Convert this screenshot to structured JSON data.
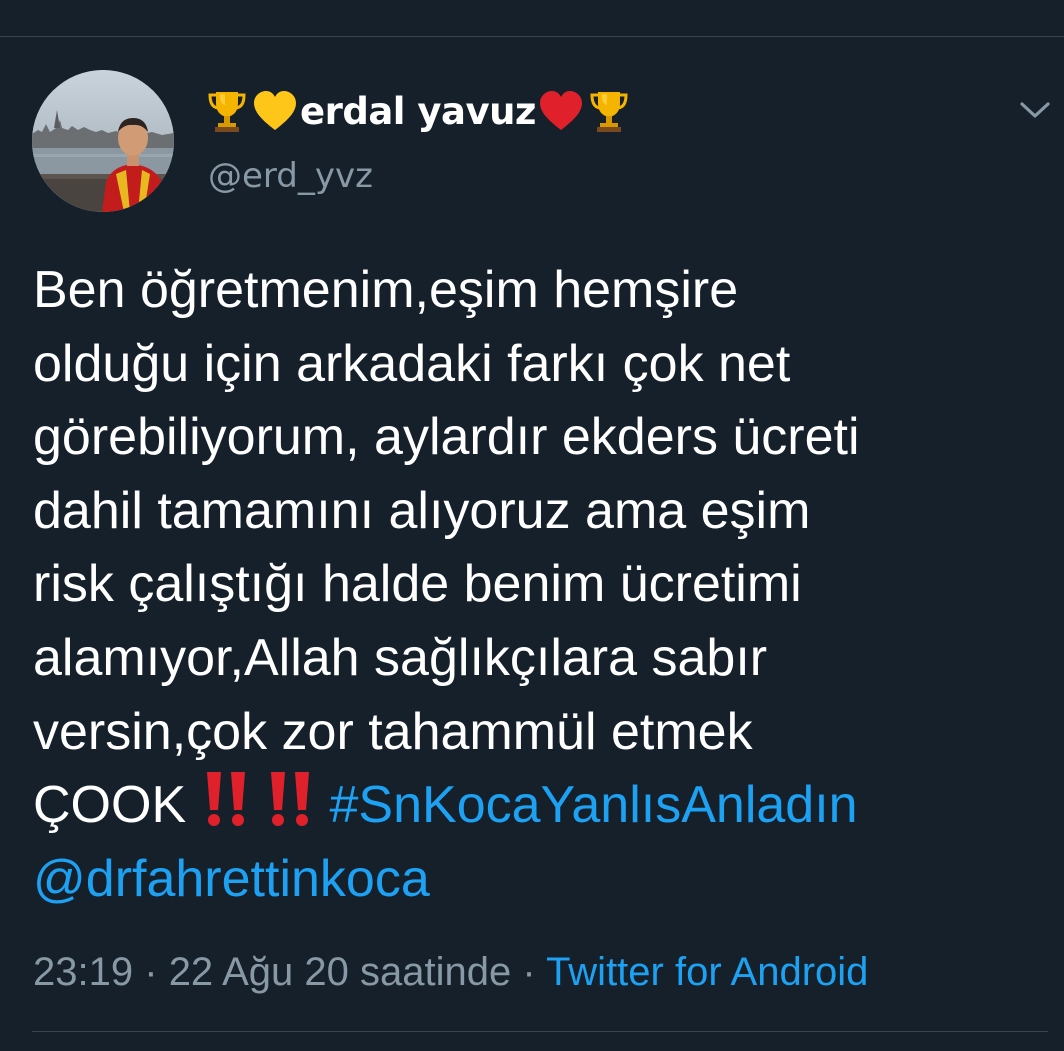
{
  "user": {
    "display_name": "erdal yavuz",
    "handle": "@erd_yvz",
    "name_emojis_left": [
      "trophy-icon",
      "yellow-heart-icon"
    ],
    "name_emojis_right": [
      "red-heart-icon",
      "trophy-icon"
    ]
  },
  "tweet": {
    "lines": [
      "Ben öğretmenim,eşim hemşire",
      "olduğu için arkadaki farkı çok net",
      "görebiliyorum, aylardır ekders ücreti",
      "dahil tamamını alıyoruz ama eşim",
      "risk çalıştığı halde benim ücretimi",
      "alamıyor,Allah sağlıkçılara sabır",
      "versin,çok zor tahammül etmek"
    ],
    "last_line_text": "ÇOOK",
    "hashtag": "#SnKocaYanlısAnladın",
    "mention": "@drfahrettinkoca"
  },
  "meta": {
    "time": "23:19",
    "date": "22 Ağu 20 saatinde",
    "separator": "·",
    "source": "Twitter for Android"
  },
  "colors": {
    "background": "#15202b",
    "text": "#ffffff",
    "secondary_text": "#8899a6",
    "link": "#1da1f2",
    "divider": "#38444d"
  }
}
